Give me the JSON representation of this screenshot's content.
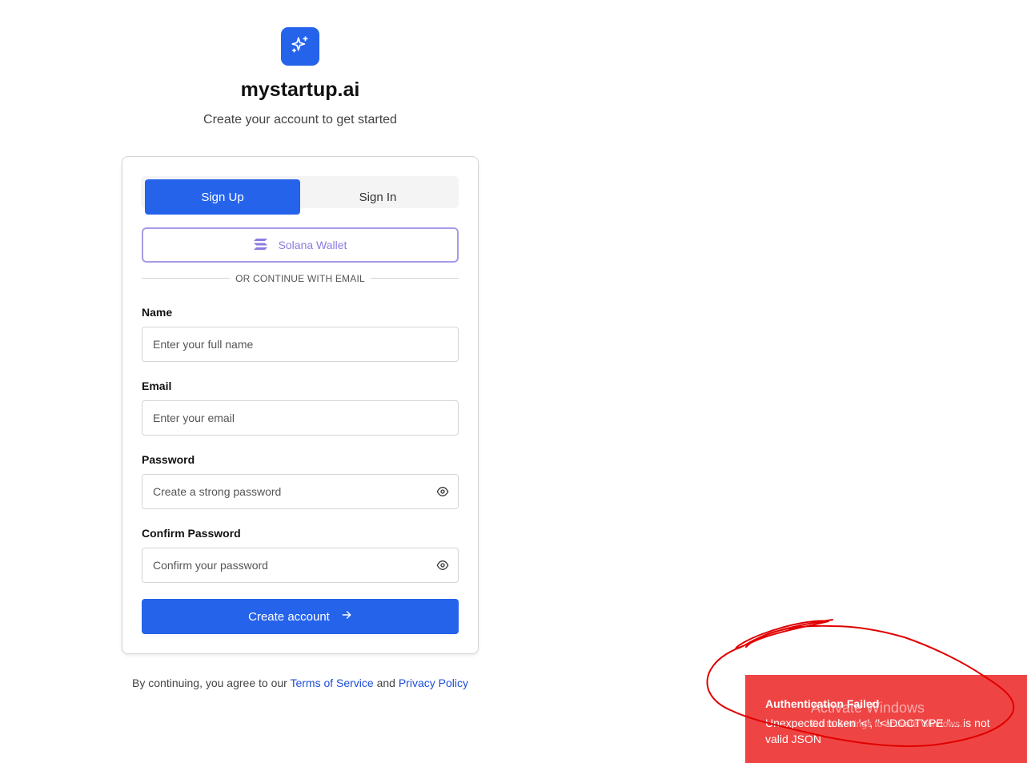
{
  "app": {
    "name": "mystartup.ai",
    "tagline": "Create your account to get started"
  },
  "auth_tabs": {
    "signup": "Sign Up",
    "signin": "Sign In",
    "active": "signup"
  },
  "wallet_button": {
    "label": "Solana Wallet",
    "icon": "solana-icon"
  },
  "divider": {
    "text": "OR CONTINUE WITH EMAIL"
  },
  "form": {
    "name": {
      "label": "Name",
      "placeholder": "Enter your full name",
      "value": ""
    },
    "email": {
      "label": "Email",
      "placeholder": "Enter your email",
      "value": ""
    },
    "password": {
      "label": "Password",
      "placeholder": "Create a strong password",
      "value": "",
      "icon": "eye-icon"
    },
    "confirm_password": {
      "label": "Confirm Password",
      "placeholder": "Confirm your password",
      "value": "",
      "icon": "eye-icon"
    },
    "submit": {
      "label": "Create account",
      "icon": "arrow-right-icon"
    }
  },
  "terms": {
    "prefix": "By continuing, you agree to our",
    "tos_link": "Terms of Service",
    "and": "and",
    "privacy_link": "Privacy Policy"
  },
  "toast": {
    "title": "Authentication Failed",
    "message": "Unexpected token '<', \"<!DOCTYPE \"... is not valid JSON"
  },
  "watermark": {
    "title": "Activate Windows",
    "subtitle": "Go to Settings to activate Windows."
  },
  "colors": {
    "primary": "#2563eb",
    "wallet_accent": "#8a7ce0",
    "toast_bg": "#ef4444",
    "annotation": "#e00000"
  }
}
